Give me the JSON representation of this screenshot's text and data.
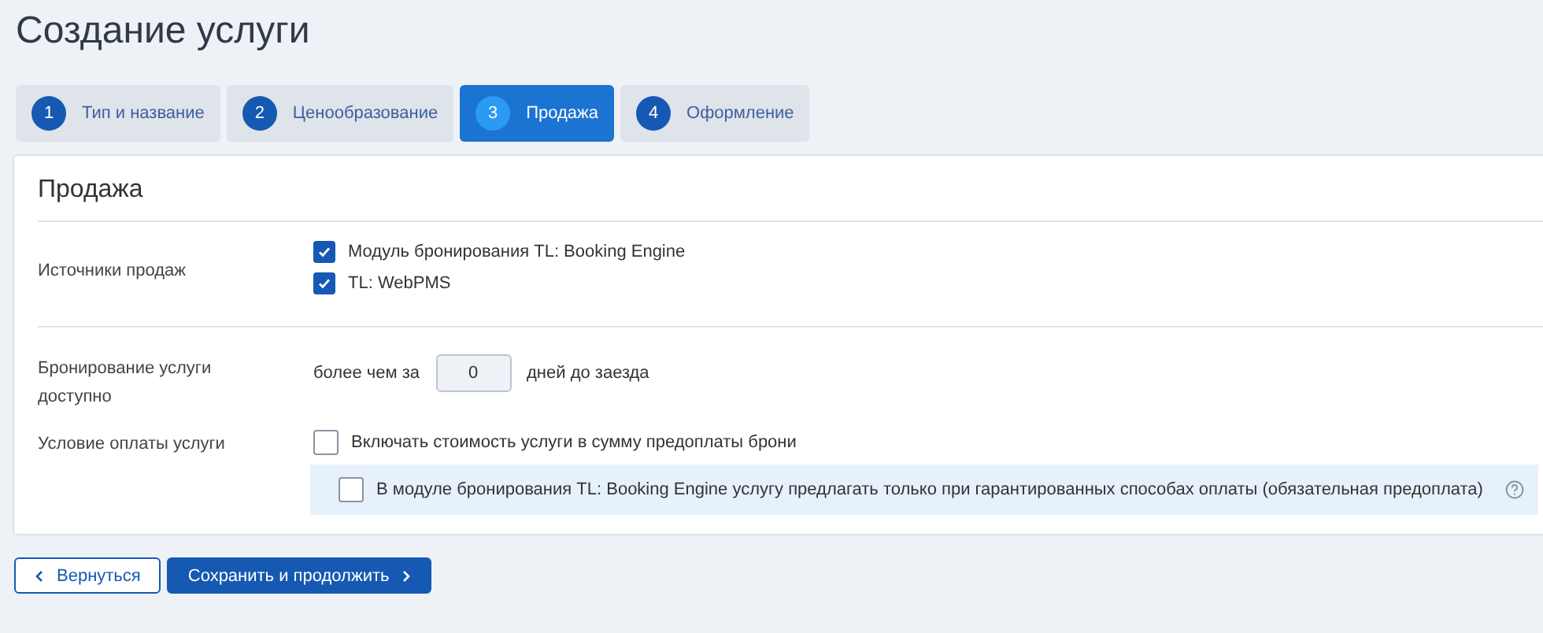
{
  "title": "Создание услуги",
  "tabs": [
    {
      "number": "1",
      "label": "Тип и название",
      "selected": false
    },
    {
      "number": "2",
      "label": "Ценообразование",
      "selected": false
    },
    {
      "number": "3",
      "label": "Продажа",
      "selected": true
    },
    {
      "number": "4",
      "label": "Оформление",
      "selected": false
    }
  ],
  "section_title": "Продажа",
  "sales_sources": {
    "label": "Источники продаж",
    "options": [
      {
        "label": "Модуль бронирования TL: Booking Engine",
        "checked": true
      },
      {
        "label": "TL: WebPMS",
        "checked": true
      }
    ]
  },
  "booking_available": {
    "label": "Бронирование услуги доступно",
    "prefix": "более чем за",
    "value": "0",
    "suffix": "дней до заезда"
  },
  "payment_condition": {
    "label": "Условие оплаты услуги",
    "option": {
      "label": "Включать стоимость услуги в сумму предоплаты брони",
      "checked": false
    },
    "sub_option": {
      "label": "В модуле бронирования TL: Booking Engine услугу предлагать только при гарантированных способах оплаты (обязательная предоплата)",
      "checked": false
    }
  },
  "buttons": {
    "back": "Вернуться",
    "save": "Сохранить и продолжить"
  }
}
